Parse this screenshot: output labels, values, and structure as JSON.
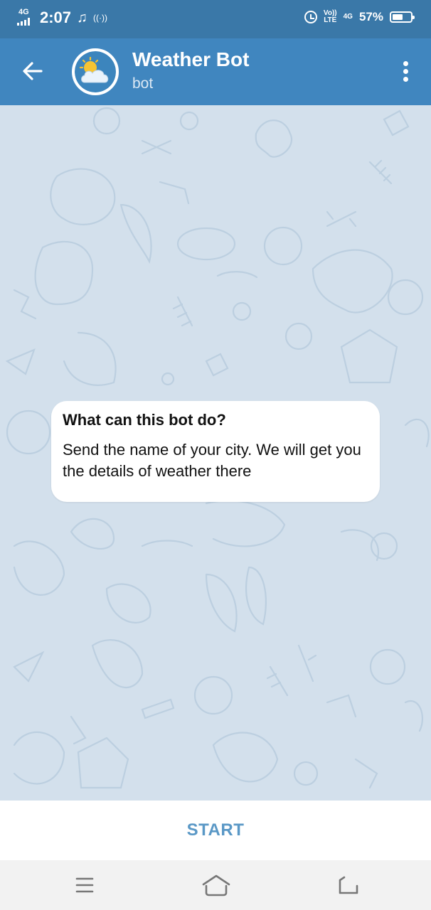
{
  "status_bar": {
    "network": "4G",
    "time": "2:07",
    "music_icon": "music-note-icon",
    "hotspot_icon": "hotspot-icon",
    "alarm_icon": "alarm-icon",
    "volte": "Vo))",
    "lte": "LTE",
    "network_right": "4G",
    "battery": "57%",
    "battery_level": 0.57
  },
  "header": {
    "title": "Weather Bot",
    "subtitle": "bot",
    "back_icon": "back-arrow-icon",
    "menu_icon": "more-vertical-icon",
    "avatar_icon": "weather-sun-cloud-icon"
  },
  "chat": {
    "intro_title": "What can this bot do?",
    "intro_text": "Send the name of your city. We will get you the details of weather there"
  },
  "start_button": {
    "label": "START"
  },
  "nav_bar": {
    "recents_icon": "recents-icon",
    "home_icon": "home-icon",
    "back_icon": "nav-back-icon"
  },
  "colors": {
    "status_bar": "#3a78a8",
    "header": "#4086bf",
    "chat_bg": "#d3e0ec",
    "start": "#5a98c6"
  }
}
